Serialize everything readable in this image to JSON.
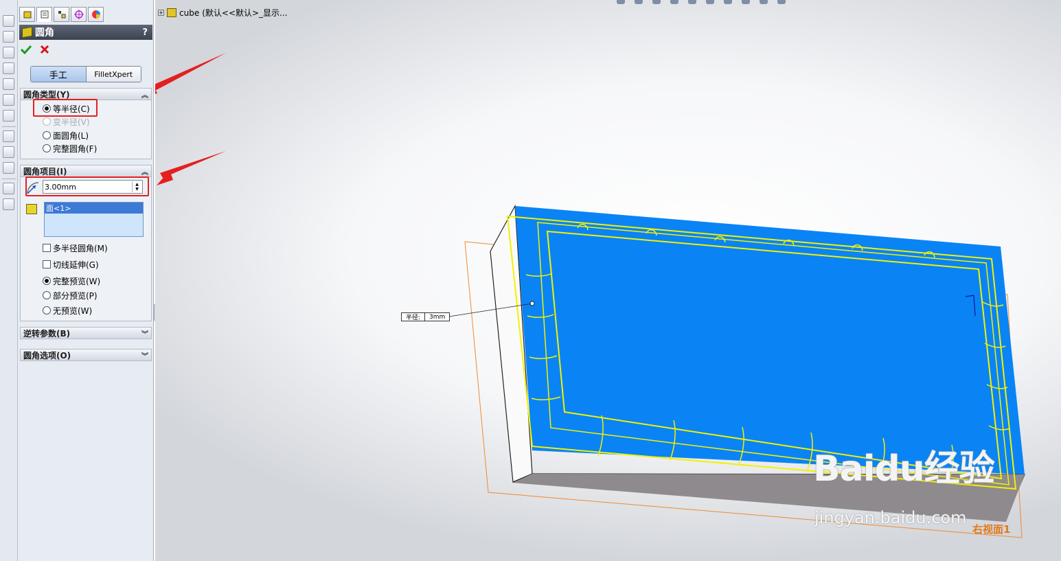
{
  "panel": {
    "title": "圆角",
    "help": "?",
    "ok_icon": "checkmark-icon",
    "cancel_icon": "x-icon",
    "mode_manual": "手工",
    "mode_expert": "FilletXpert",
    "fillet_type": {
      "header": "圆角类型(Y)",
      "options": [
        "等半径(C)",
        "变半径(V)",
        "面圆角(L)",
        "完整圆角(F)"
      ],
      "selected": "等半径(C)"
    },
    "fillet_items": {
      "header": "圆角项目(I)",
      "radius_value": "3.00mm",
      "selection": "面<1>",
      "multi_radius": "多半径圆角(M)",
      "tangent": "切线延伸(G)",
      "preview_full": "完整预览(W)",
      "preview_partial": "部分预览(P)",
      "preview_none": "无预览(W)"
    },
    "reverse_params": "逆转参数(B)",
    "fillet_options": "圆角选项(O)"
  },
  "viewport": {
    "tree_item": "cube",
    "tree_suffix": "(默认<<默认>_显示...",
    "dim_label": "半径:",
    "dim_value": "3mm",
    "plane_label": "右视面1",
    "watermark_logo": "Baidu经验",
    "watermark_url": "jingyan.baidu.com"
  },
  "colors": {
    "face_blue": "#0a84f5",
    "fillet_yellow": "#f2f200",
    "plane_orange": "#f08a2e",
    "arrow_red": "#e51f1f"
  }
}
